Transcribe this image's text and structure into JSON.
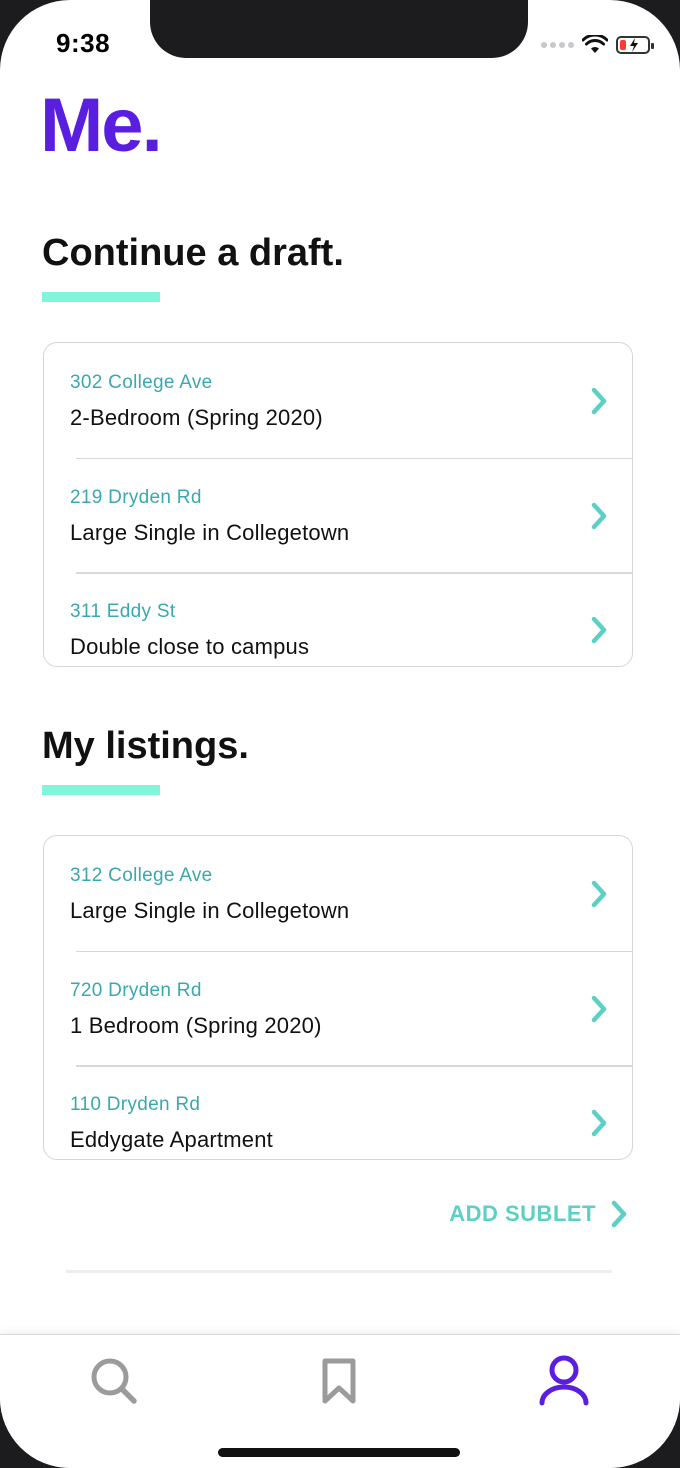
{
  "status_bar": {
    "time": "9:38"
  },
  "page": {
    "title": "Me."
  },
  "drafts": {
    "heading": "Continue a draft.",
    "items": [
      {
        "address": "302 College Ave",
        "description": "2-Bedroom (Spring 2020)"
      },
      {
        "address": "219 Dryden Rd",
        "description": "Large Single in Collegetown"
      },
      {
        "address": "311 Eddy St",
        "description": "Double close to campus"
      }
    ]
  },
  "listings": {
    "heading": "My listings.",
    "items": [
      {
        "address": "312 College Ave",
        "description": "Large Single in Collegetown"
      },
      {
        "address": "720 Dryden Rd",
        "description": "1 Bedroom (Spring 2020)"
      },
      {
        "address": "110 Dryden Rd",
        "description": "Eddygate Apartment"
      }
    ]
  },
  "actions": {
    "add_sublet": "ADD SUBLET"
  },
  "tab_bar": {
    "tabs": [
      {
        "icon": "search-icon",
        "active": false
      },
      {
        "icon": "bookmark-icon",
        "active": false
      },
      {
        "icon": "profile-icon",
        "active": true
      }
    ]
  },
  "colors": {
    "brand_purple": "#5a1ee0",
    "accent_teal": "#3aa8b0",
    "chevron_teal": "#5cd0c6",
    "underline_mint": "#7ff5d9",
    "inactive_icon": "#9b9b9b"
  }
}
